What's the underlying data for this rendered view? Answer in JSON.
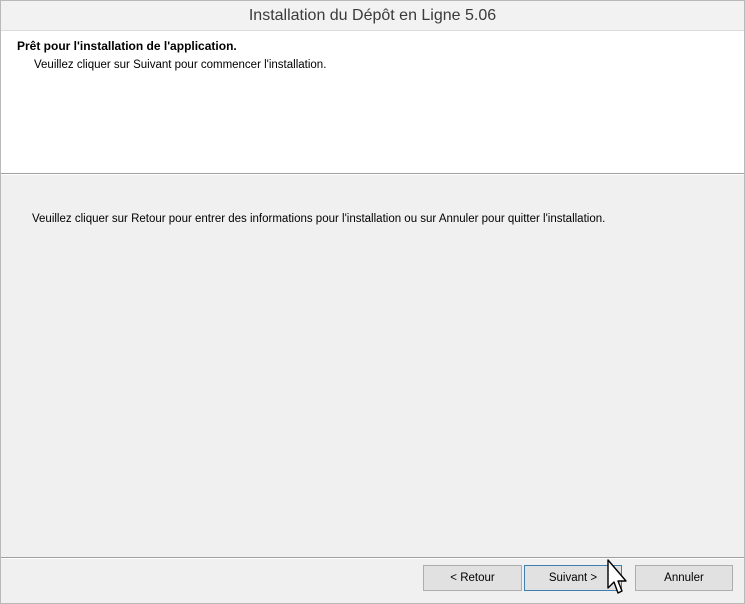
{
  "window": {
    "title": "Installation du Dépôt en Ligne 5.06"
  },
  "banner": {
    "title": "Prêt pour l'installation de l'application.",
    "subtitle": "Veuillez cliquer sur Suivant pour commencer l'installation."
  },
  "main": {
    "instructions": "Veuillez cliquer sur Retour pour entrer des informations pour l'installation ou sur Annuler pour quitter l'installation."
  },
  "buttons": {
    "back": "< Retour",
    "next": "Suivant >",
    "cancel": "Annuler"
  },
  "cursor": {
    "icon": "mouse-pointer-icon"
  }
}
